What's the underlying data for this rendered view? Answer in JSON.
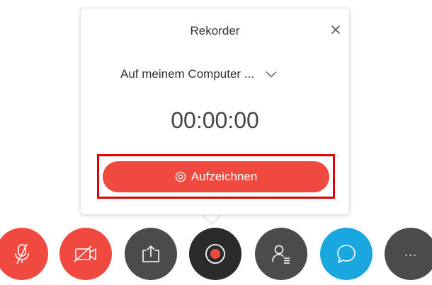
{
  "recorder": {
    "title": "Rekorder",
    "destination": "Auf meinem Computer ...",
    "timer": "00:00:00",
    "record_label": "Aufzeichnen",
    "accent": "#f0493f",
    "highlight_color": "#e00000"
  },
  "toolbar": {
    "buttons": [
      {
        "name": "mute-button",
        "icon": "microphone-muted-icon",
        "color": "#f0493f"
      },
      {
        "name": "video-off-button",
        "icon": "camera-off-icon",
        "color": "#f0493f"
      },
      {
        "name": "share-button",
        "icon": "share-icon",
        "color": "#4b4b4b"
      },
      {
        "name": "recorder-button",
        "icon": "record-icon",
        "color": "#2b2b2b"
      },
      {
        "name": "participants-button",
        "icon": "participants-icon",
        "color": "#4b4b4b"
      },
      {
        "name": "chat-button",
        "icon": "chat-icon",
        "color": "#1aa7e0"
      },
      {
        "name": "more-button",
        "icon": "more-icon",
        "color": "#4b4b4b"
      }
    ],
    "more_label": "..."
  }
}
